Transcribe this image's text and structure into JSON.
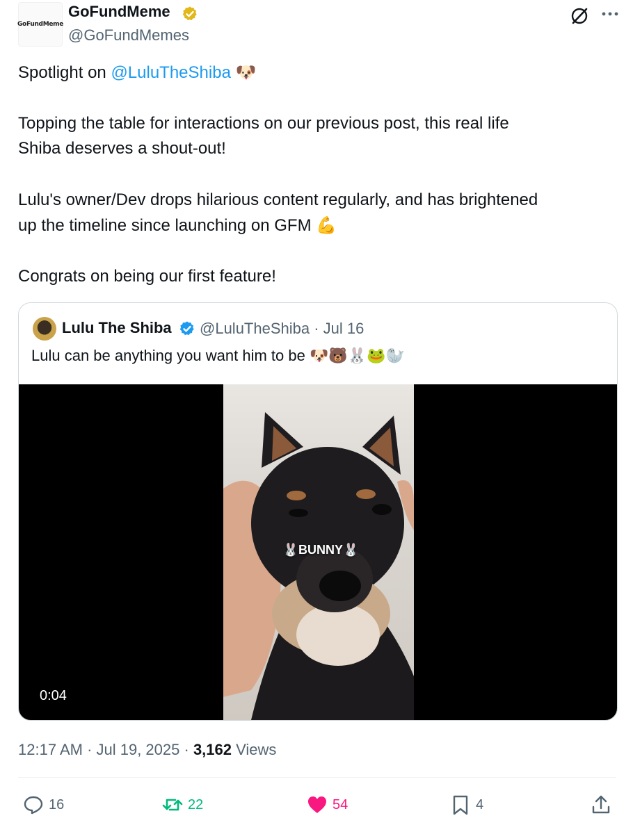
{
  "header": {
    "display_name": "GoFundMeme",
    "handle": "@GoFundMemes",
    "avatar_text": "GoFundMeme"
  },
  "tweet": {
    "line1_prefix": "Spotlight on ",
    "line1_mention": "@LuluTheShiba",
    "line1_emoji": "🐶",
    "p2_line1": "Topping the table for interactions on our previous post, this real life",
    "p2_line2": "Shiba deserves a shout-out!",
    "p3_line1": "Lulu's owner/Dev drops hilarious content regularly, and has brightened",
    "p3_line2": "up the timeline since launching on GFM",
    "p3_emoji": "💪",
    "p4": "Congrats on being our first feature!"
  },
  "quote": {
    "display_name": "Lulu The Shiba",
    "handle_date": "@LuluTheShiba · Jul 16",
    "text": "Lulu can be anything you want him to be",
    "emojis": "🐶🐻🐰🐸🦭",
    "video_overlay": "🐰BUNNY🐰",
    "duration": "0:04"
  },
  "meta": {
    "time_date": "12:17 AM · Jul 19, 2025 · ",
    "views_count": "3,162",
    "views_label": " Views"
  },
  "actions": {
    "replies": "16",
    "retweets": "22",
    "likes": "54",
    "bookmarks": "4"
  },
  "colors": {
    "mention": "#1d9bf0",
    "secondary_text": "#536471",
    "retweet": "#00ba7c",
    "like": "#f91880",
    "verified_gold": "#e2b719",
    "verified_blue": "#1d9bf0"
  }
}
